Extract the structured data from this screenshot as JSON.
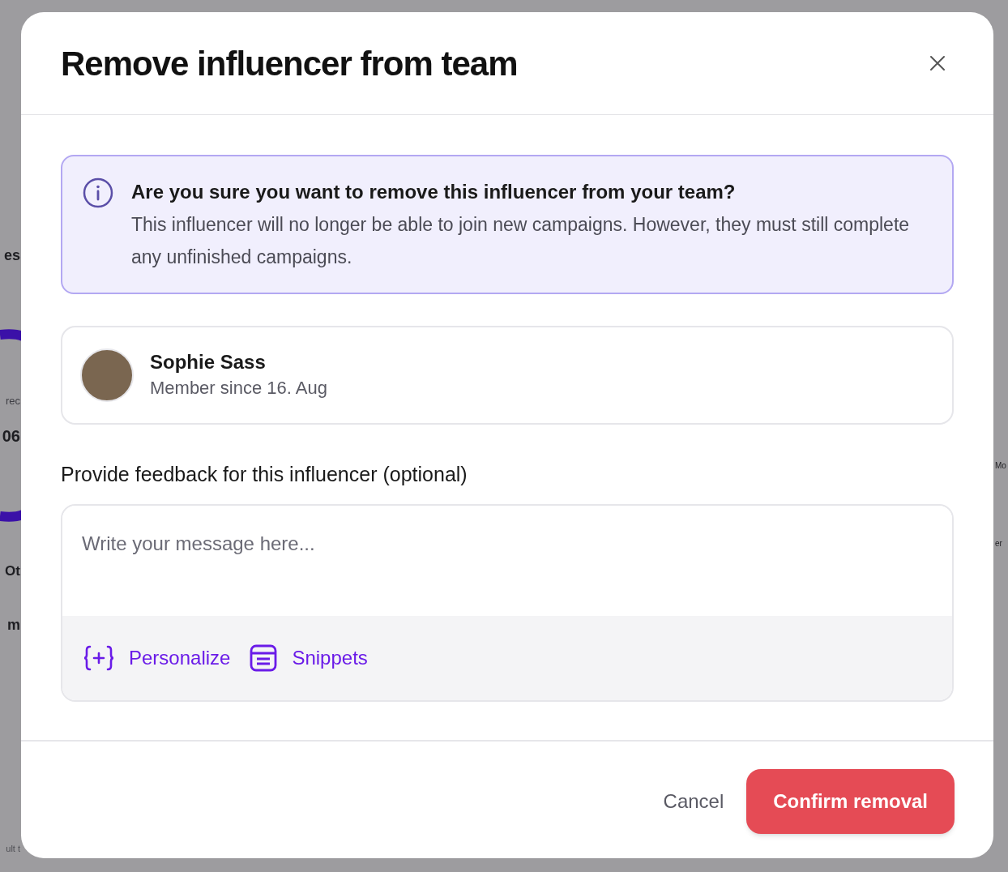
{
  "backdrop_left_texts": [
    "es",
    "rec",
    "06",
    "Ot",
    "m",
    "ult t"
  ],
  "backdrop_right_texts": [
    "Mo",
    "er"
  ],
  "dialog": {
    "title": "Remove influencer from team",
    "alert": {
      "heading": "Are you sure you want to remove this influencer from your team?",
      "body": "This influencer will no longer be able to join new campaigns. However, they must still complete any unfinished campaigns."
    },
    "member": {
      "name": "Sophie Sass",
      "subtitle": "Member since 16. Aug"
    },
    "feedback": {
      "label": "Provide feedback for this influencer (optional)",
      "placeholder": "Write your message here...",
      "tools": [
        {
          "kind": "personalize",
          "label": "Personalize"
        },
        {
          "kind": "snippets",
          "label": "Snippets"
        }
      ]
    },
    "buttons": [
      {
        "kind": "secondary",
        "label": "Cancel"
      },
      {
        "kind": "danger",
        "label": "Confirm removal"
      }
    ]
  }
}
